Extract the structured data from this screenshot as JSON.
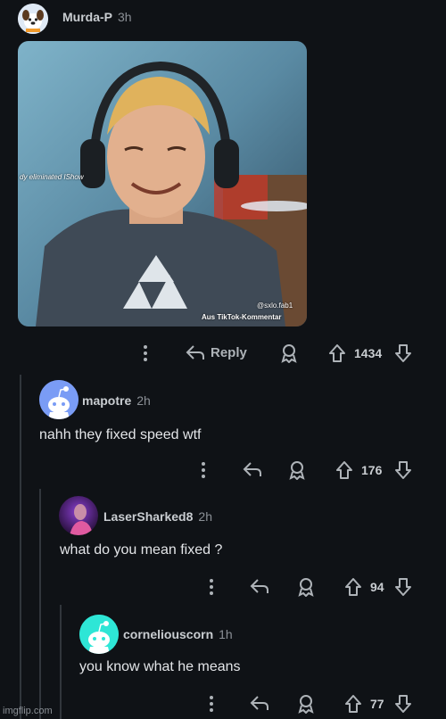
{
  "comments": [
    {
      "username": "Murda-P",
      "age": "3h",
      "image": {
        "overlay_left": "dy eliminated IShow",
        "overlay_handle": "@sxlo.fab1",
        "overlay_tiktok": "Aus TikTok-Kommentar"
      },
      "reply_label": "Reply",
      "votes": "1434"
    },
    {
      "username": "mapotre",
      "age": "2h",
      "text": "nahh they fixed speed wtf",
      "votes": "176"
    },
    {
      "username": "LaserSharked8",
      "age": "2h",
      "text": "what do you mean fixed ?",
      "votes": "94"
    },
    {
      "username": "corneliouscorn",
      "age": "1h",
      "text": "you know what he means",
      "votes": "77"
    }
  ],
  "watermark": "imgflip.com",
  "colors": {
    "background": "#0f1216",
    "thread_line": "#31363c",
    "avatar_blue": "#7a9cf5",
    "avatar_teal": "#2ee6d6"
  }
}
